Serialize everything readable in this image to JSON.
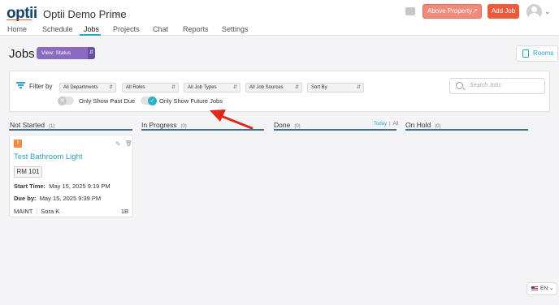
{
  "header": {
    "logo_text": "optii",
    "org_name": "Optii Demo Prime",
    "about_property_label": "Above Property",
    "add_job_label": "Add Job",
    "colors": {
      "accent": "#ef5a3c",
      "brand": "#17456b",
      "link": "#2aa3c8"
    }
  },
  "nav": {
    "items": [
      {
        "label": "Home"
      },
      {
        "label": "Schedule"
      },
      {
        "label": "Jobs",
        "active": true
      },
      {
        "label": "Projects"
      },
      {
        "label": "Chat"
      },
      {
        "label": "Reports"
      },
      {
        "label": "Settings"
      }
    ]
  },
  "page": {
    "title": "Jobs",
    "view_select": "View: Status",
    "rooms_label": "Rooms"
  },
  "filters": {
    "label": "Filter by",
    "selects": [
      {
        "value": "All Departments"
      },
      {
        "value": "All Roles"
      },
      {
        "value": "All Job Types"
      },
      {
        "value": "All Job Sources"
      },
      {
        "value": "Sort By"
      }
    ],
    "search_placeholder": "Search Jobs",
    "past_due_label": "Only Show Past Due",
    "past_due_on": false,
    "future_jobs_label": "Only Show Future Jobs",
    "future_jobs_on": true
  },
  "columns": [
    {
      "name": "Not Started",
      "count": "(1)"
    },
    {
      "name": "In Progress",
      "count": "(0)"
    },
    {
      "name": "Done",
      "count": "(0)",
      "filter_today": "Today",
      "filter_all": "All"
    },
    {
      "name": "On Hold",
      "count": "(0)"
    }
  ],
  "card": {
    "title": "Test Bathroom Light",
    "room": "RM 101",
    "start_label": "Start Time:",
    "start_value": "May 15, 2025 9:19 PM",
    "due_label": "Due by:",
    "due_value": "May 15, 2025 9:39 PM",
    "department": "MAINT",
    "assignee": "Sora K",
    "floor": "1B",
    "priority_icon": "warning-icon"
  },
  "footer": {
    "language": "EN"
  }
}
